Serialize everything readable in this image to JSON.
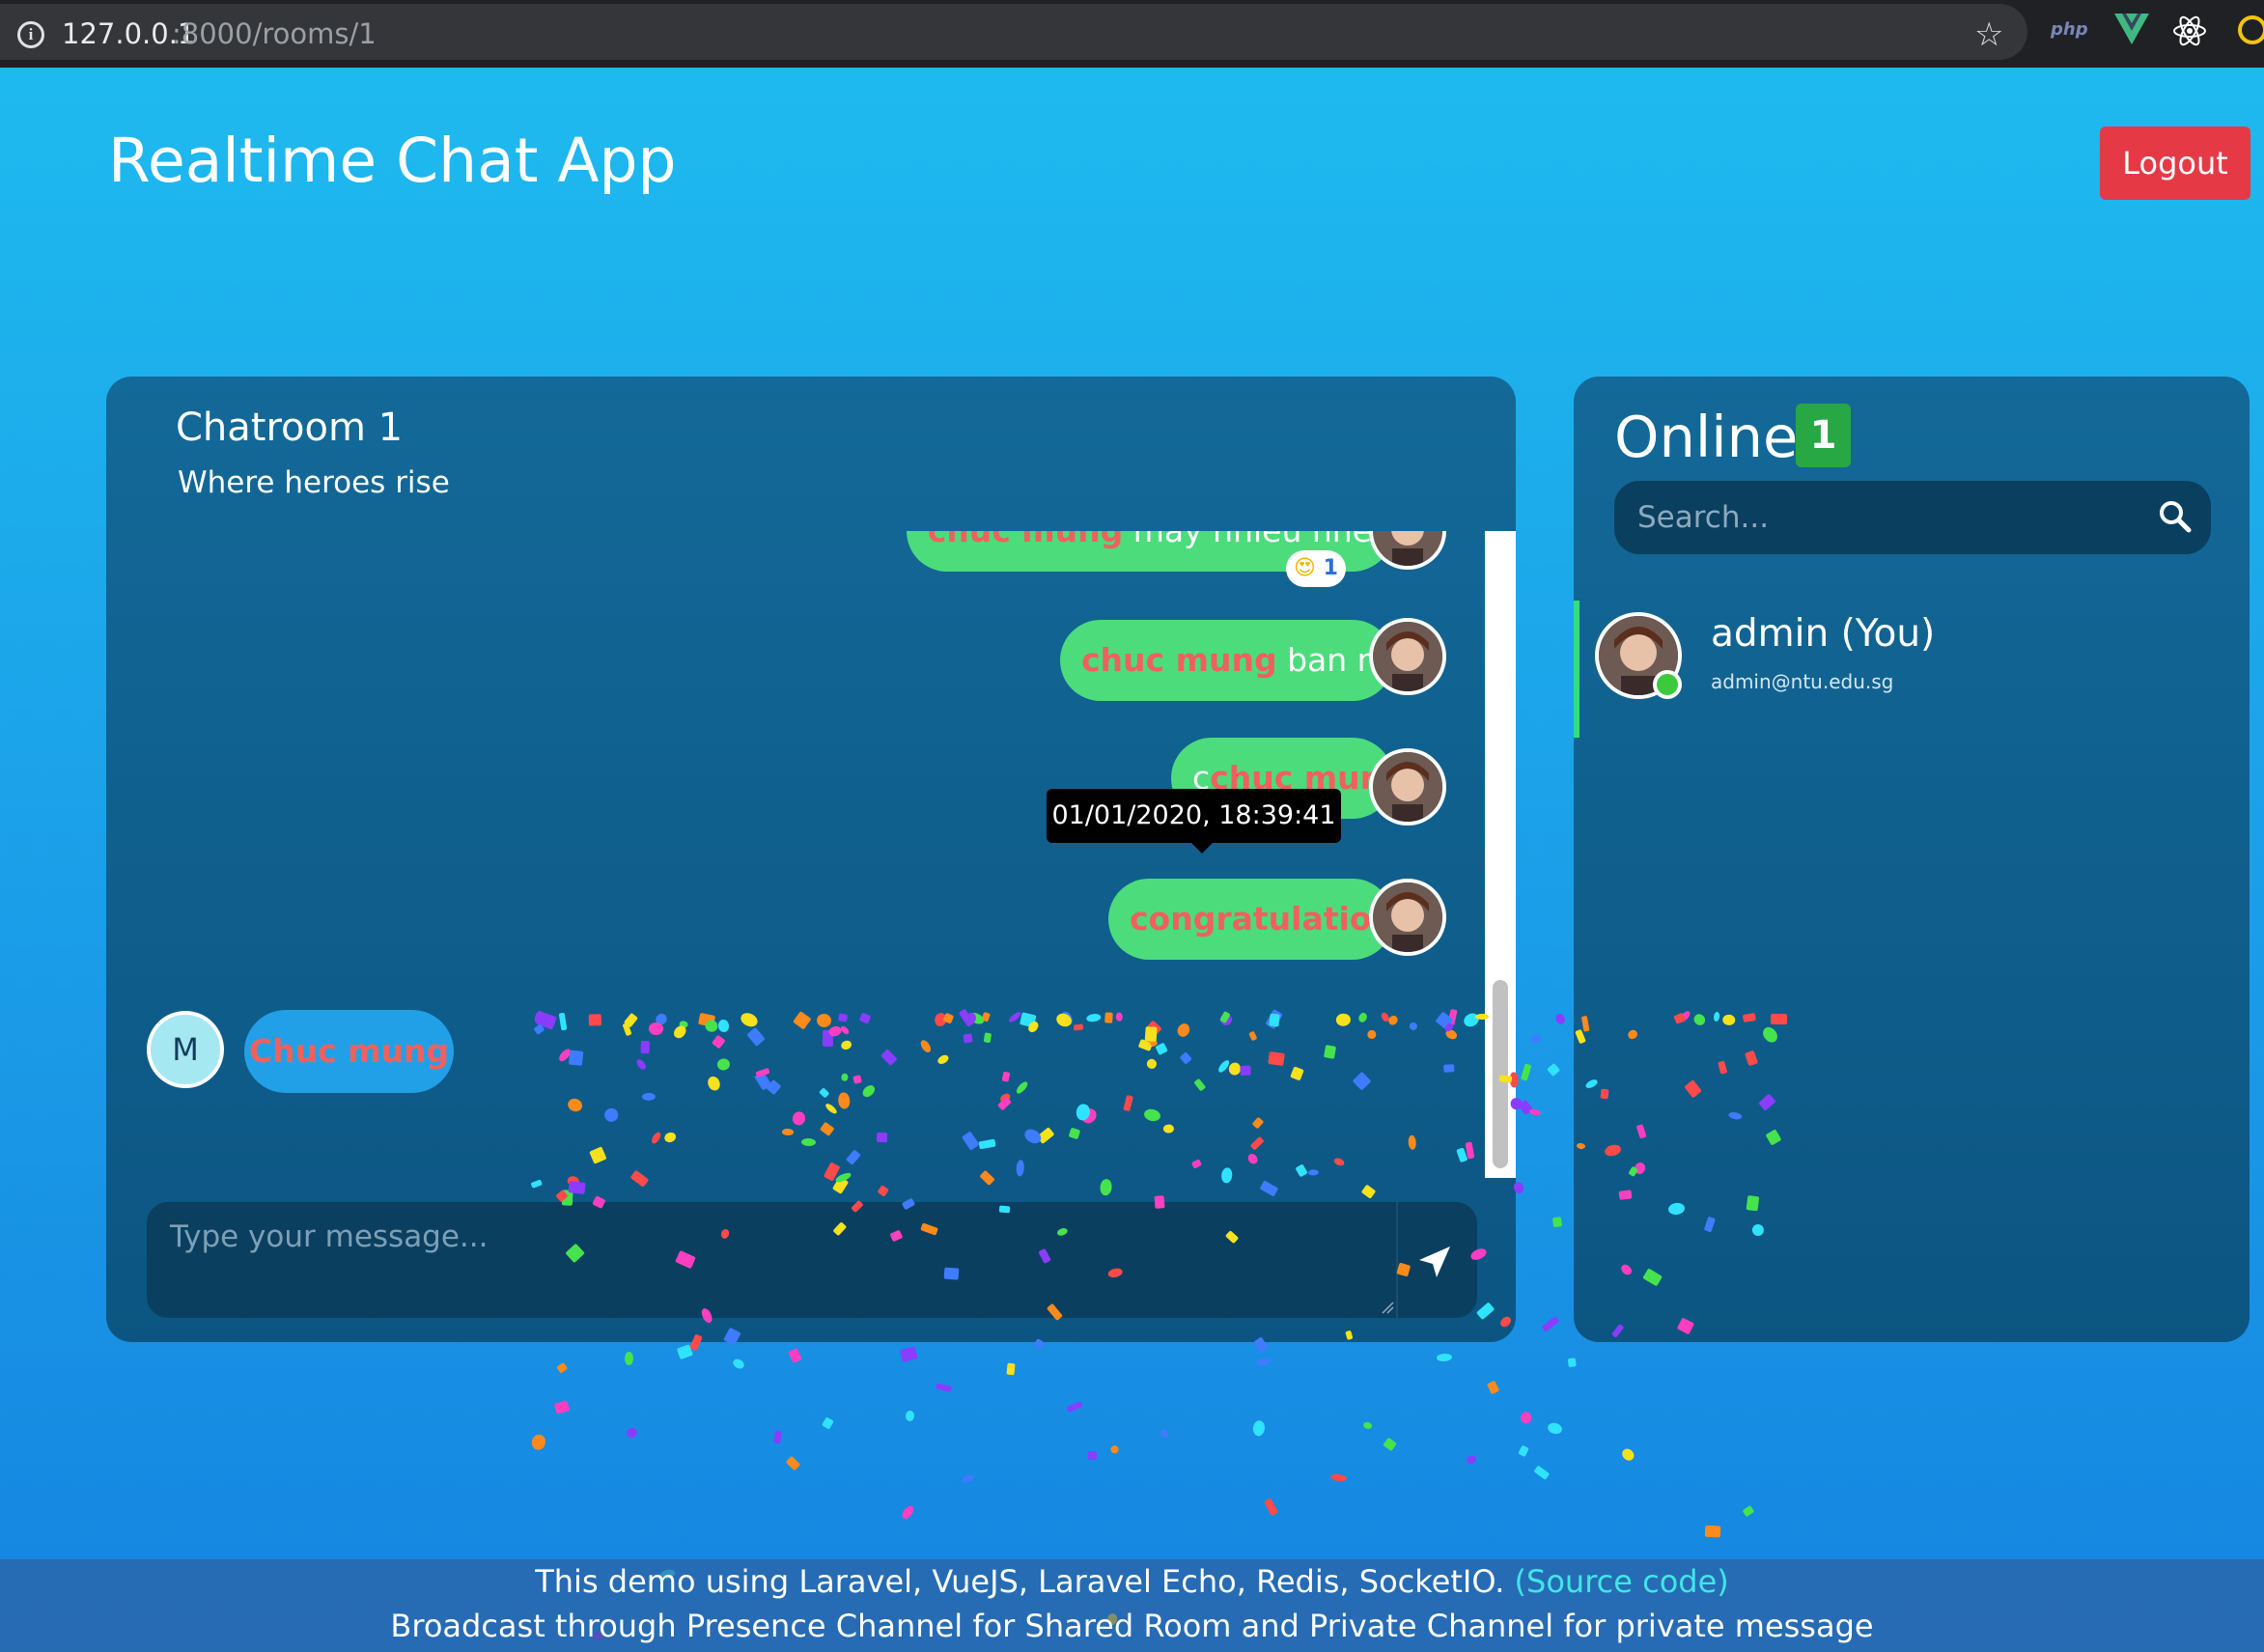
{
  "browser": {
    "url_host": "127.0.0.1",
    "url_path": ":8000/rooms/1",
    "extensions": [
      "php",
      "vue-icon",
      "react-icon",
      "chrome-ext-icon"
    ]
  },
  "header": {
    "title": "Realtime Chat App",
    "logout_label": "Logout"
  },
  "chat": {
    "room_name": "Chatroom 1",
    "room_description": "Where heroes rise",
    "messages": [
      {
        "sender": "me",
        "highlight": "chuc mung",
        "text": " may nhieu nhe",
        "reaction_emoji": "😍",
        "reaction_count": "1"
      },
      {
        "sender": "me",
        "highlight": "chuc mung",
        "text": " ban nhe"
      },
      {
        "sender": "me",
        "prefix": "c",
        "highlight": "chuc mung",
        "text": ""
      },
      {
        "sender": "me",
        "highlight": "congratulations",
        "text": "",
        "tooltip": "01/01/2020, 18:39:41"
      },
      {
        "sender": "other",
        "avatar_initial": "M",
        "highlight": "Chuc mung",
        "text": ""
      }
    ],
    "input_placeholder": "Type your message..."
  },
  "online": {
    "title": "Online",
    "count": "1",
    "search_placeholder": "Search...",
    "users": [
      {
        "name": "admin (You)",
        "email": "admin@ntu.edu.sg",
        "status": "online"
      }
    ]
  },
  "footer": {
    "line1_prefix": "This demo using Laravel, VueJS, Laravel Echo, Redis, SocketIO. ",
    "source_link": "(Source code)",
    "line2": "Broadcast through Presence Channel for Shared Room and Private Channel for private message"
  },
  "colors": {
    "accent_green": "#4cdc7c",
    "highlight_red": "#f0605d",
    "logout_red": "#e63946",
    "online_badge": "#28a745",
    "other_bubble": "#22a0e7"
  }
}
